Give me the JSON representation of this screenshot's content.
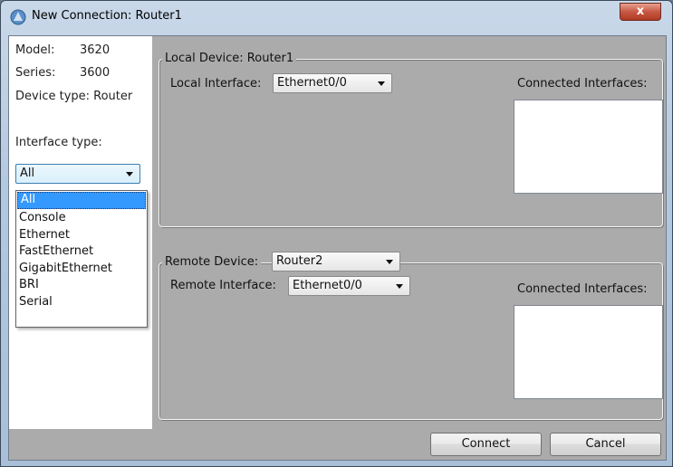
{
  "window": {
    "title": "New Connection: Router1",
    "close_label": "x"
  },
  "device_info": {
    "model_label": "Model:",
    "model_value": "3620",
    "series_label": "Series:",
    "series_value": "3600",
    "device_type": "Device type: Router"
  },
  "interface_type": {
    "label": "Interface type:",
    "selected": "All",
    "options": [
      "All",
      "Console",
      "Ethernet",
      "FastEthernet",
      "GigabitEthernet",
      "BRI",
      "Serial"
    ]
  },
  "local": {
    "legend": "Local Device: Router1",
    "interface_label": "Local Interface:",
    "interface_value": "Ethernet0/0",
    "connected_label": "Connected Interfaces:"
  },
  "remote": {
    "device_label": "Remote Device:",
    "device_value": "Router2",
    "interface_label": "Remote Interface:",
    "interface_value": "Ethernet0/0",
    "connected_label": "Connected Interfaces:"
  },
  "buttons": {
    "connect": "Connect",
    "cancel": "Cancel"
  },
  "colors": {
    "selection": "#3399ff",
    "panel": "#ababab"
  }
}
